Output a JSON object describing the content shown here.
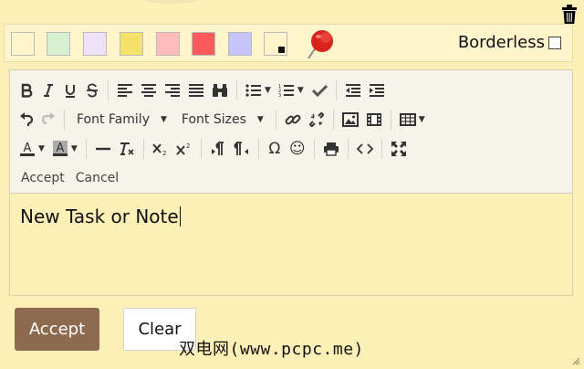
{
  "colors": {
    "background": "#fdf0b6",
    "accent_button": "#8e6b4e",
    "pin": "#d9231d"
  },
  "swatches": [
    {
      "name": "white-yellow",
      "color": "#fff5cc"
    },
    {
      "name": "light-green",
      "color": "#d7f0cf"
    },
    {
      "name": "lavender",
      "color": "#efe1f7"
    },
    {
      "name": "yellow",
      "color": "#f5e26b"
    },
    {
      "name": "pink",
      "color": "#fdbbbb"
    },
    {
      "name": "red",
      "color": "#fa5a5a"
    },
    {
      "name": "periwinkle",
      "color": "#c5c4f8"
    },
    {
      "name": "borderless",
      "color": "#fff5cc"
    }
  ],
  "colorbar": {
    "borderless_label": "Borderless"
  },
  "toolbar": {
    "font_family_label": "Font Family",
    "font_sizes_label": "Font Sizes",
    "accept_label": "Accept",
    "cancel_label": "Cancel",
    "omega_glyph": "Ω",
    "smiley_glyph": "☺"
  },
  "editor": {
    "content_text": "New Task or Note"
  },
  "buttons": {
    "accept_label": "Accept",
    "clear_label": "Clear"
  },
  "watermark": "双电网(www.pcpc.me)"
}
